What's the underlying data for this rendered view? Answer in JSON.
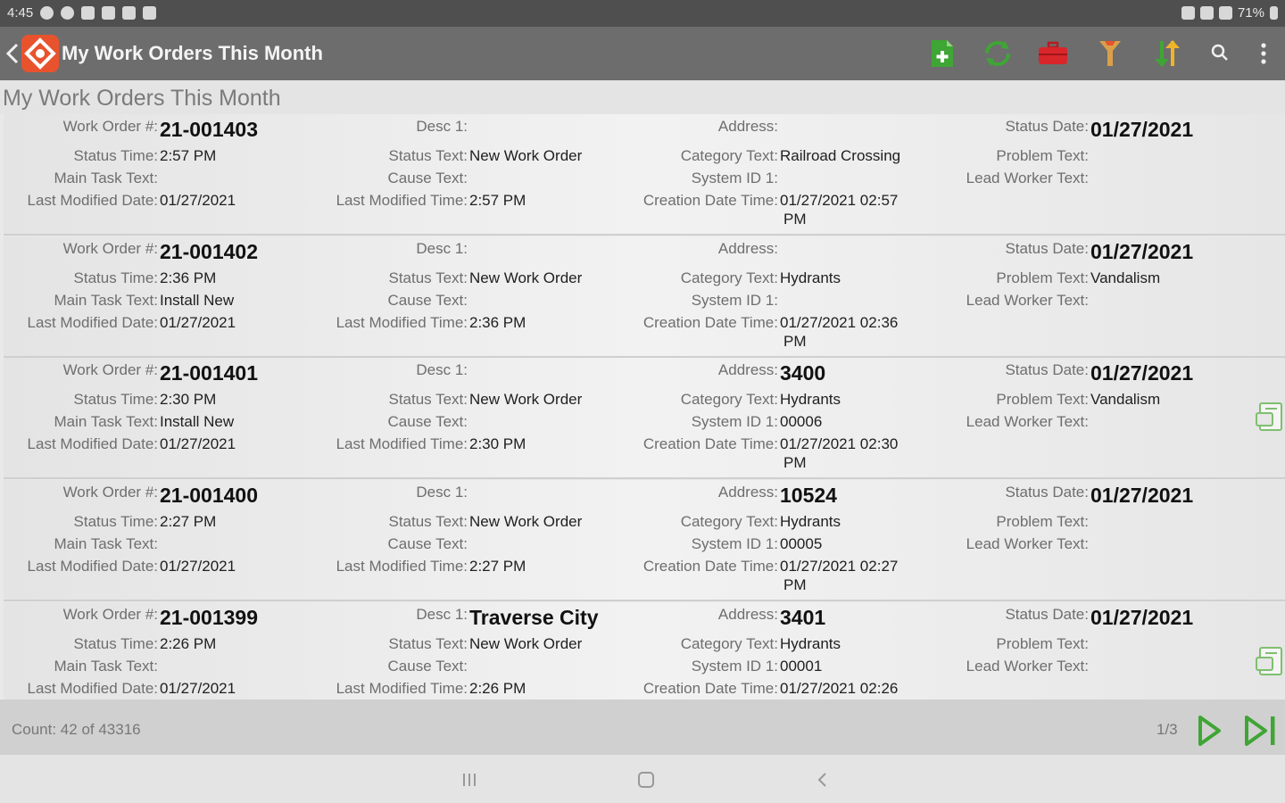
{
  "status_bar": {
    "time": "4:45",
    "battery": "71%"
  },
  "toolbar": {
    "title": "My Work Orders This Month",
    "icons": [
      "back-arrow-icon",
      "app-logo",
      "add-document-icon",
      "refresh-icon",
      "toolbox-icon",
      "filter-icon",
      "sort-icon",
      "search-icon",
      "more-vert-icon"
    ],
    "accent_green": "#3fa535",
    "accent_red": "#d9262b"
  },
  "page": {
    "title": "My Work Orders This Month"
  },
  "labels": {
    "work_order": "Work Order #:",
    "status_time": "Status Time:",
    "main_task": "Main Task Text:",
    "last_mod_date": "Last Modified Date:",
    "desc": "Desc 1:",
    "status_text": "Status Text:",
    "cause": "Cause Text:",
    "last_mod_time": "Last Modified Time:",
    "address": "Address:",
    "category": "Category Text:",
    "system_id": "System ID 1:",
    "creation": "Creation Date Time:",
    "status_date": "Status Date:",
    "problem": "Problem Text:",
    "lead_worker": "Lead Worker Text:"
  },
  "work_orders": [
    {
      "wo": "21-001403",
      "status_time": "2:57 PM",
      "main_task": "",
      "last_mod_date": "01/27/2021",
      "desc": "",
      "status_text": "New Work Order",
      "cause": "",
      "last_mod_time": "2:57 PM",
      "address": "",
      "category": "Railroad Crossing",
      "system_id": "",
      "creation": "01/27/2021 02:57",
      "creation_pm": "PM",
      "status_date": "01/27/2021",
      "problem": "",
      "lead_worker": "",
      "attachment": false
    },
    {
      "wo": "21-001402",
      "status_time": "2:36 PM",
      "main_task": "Install New",
      "last_mod_date": "01/27/2021",
      "desc": "",
      "status_text": "New Work Order",
      "cause": "",
      "last_mod_time": "2:36 PM",
      "address": "",
      "category": "Hydrants",
      "system_id": "",
      "creation": "01/27/2021 02:36",
      "creation_pm": "PM",
      "status_date": "01/27/2021",
      "problem": "Vandalism",
      "lead_worker": "",
      "attachment": false
    },
    {
      "wo": "21-001401",
      "status_time": "2:30 PM",
      "main_task": "Install New",
      "last_mod_date": "01/27/2021",
      "desc": "",
      "status_text": "New Work Order",
      "cause": "",
      "last_mod_time": "2:30 PM",
      "address": "3400",
      "category": "Hydrants",
      "system_id": "00006",
      "creation": "01/27/2021 02:30",
      "creation_pm": "PM",
      "status_date": "01/27/2021",
      "problem": "Vandalism",
      "lead_worker": "",
      "attachment": true
    },
    {
      "wo": "21-001400",
      "status_time": "2:27 PM",
      "main_task": "",
      "last_mod_date": "01/27/2021",
      "desc": "",
      "status_text": "New Work Order",
      "cause": "",
      "last_mod_time": "2:27 PM",
      "address": "10524",
      "category": "Hydrants",
      "system_id": "00005",
      "creation": "01/27/2021 02:27",
      "creation_pm": "PM",
      "status_date": "01/27/2021",
      "problem": "",
      "lead_worker": "",
      "attachment": false
    },
    {
      "wo": "21-001399",
      "status_time": "2:26 PM",
      "main_task": "",
      "last_mod_date": "01/27/2021",
      "desc": "Traverse City",
      "status_text": "New Work Order",
      "cause": "",
      "last_mod_time": "2:26 PM",
      "address": "3401",
      "category": "Hydrants",
      "system_id": "00001",
      "creation": "01/27/2021 02:26",
      "creation_pm": "",
      "status_date": "01/27/2021",
      "problem": "",
      "lead_worker": "",
      "attachment": true
    }
  ],
  "footer": {
    "count": "Count: 42 of 43316",
    "page": "1/3"
  }
}
